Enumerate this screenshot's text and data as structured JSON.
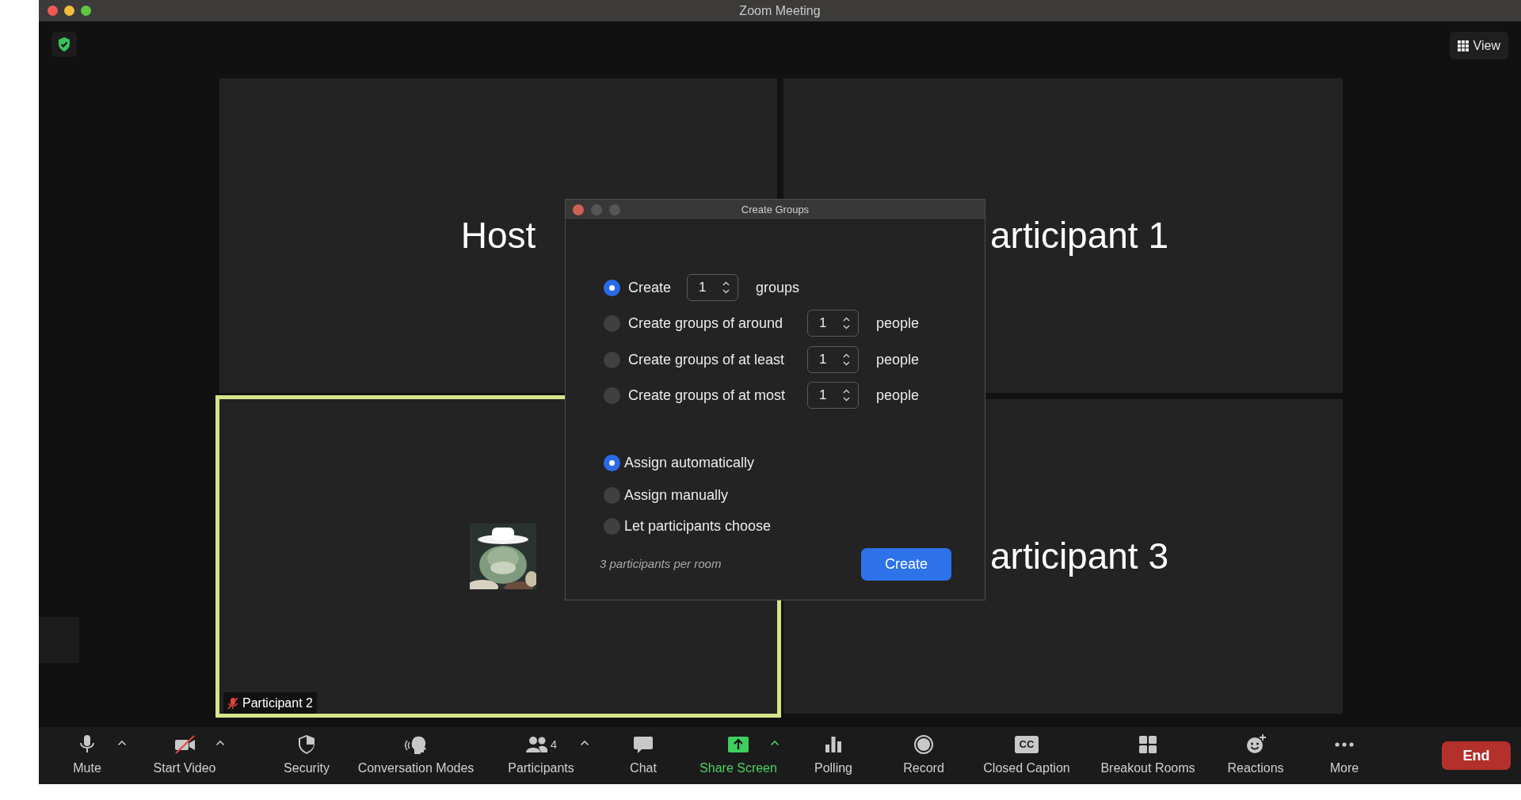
{
  "window": {
    "title": "Zoom Meeting"
  },
  "top_bar": {
    "view_button": "View"
  },
  "tiles": [
    {
      "kind": "label",
      "label": "Host",
      "speaking": false
    },
    {
      "kind": "label",
      "label": "articipant 1",
      "speaking": false
    },
    {
      "kind": "avatar",
      "label": "Participant 2",
      "muted": true,
      "speaking": true
    },
    {
      "kind": "label",
      "label": "articipant 3",
      "speaking": false
    }
  ],
  "dialog": {
    "title": "Create Groups",
    "group_options": [
      {
        "label": "Create",
        "value": "1",
        "unit": "groups",
        "selected": true
      },
      {
        "label": "Create groups of around",
        "value": "1",
        "unit": "people",
        "selected": false
      },
      {
        "label": "Create groups of at least",
        "value": "1",
        "unit": "people",
        "selected": false
      },
      {
        "label": "Create groups of at most",
        "value": "1",
        "unit": "people",
        "selected": false
      }
    ],
    "assign_options": [
      {
        "label": "Assign automatically",
        "selected": true
      },
      {
        "label": "Assign manually",
        "selected": false
      },
      {
        "label": "Let participants choose",
        "selected": false
      }
    ],
    "summary": "3 participants per room",
    "button": "Create"
  },
  "toolbar": {
    "items": [
      {
        "label": "Mute",
        "caret": true,
        "highlighted": false
      },
      {
        "label": "Start Video",
        "caret": true,
        "highlighted": false
      },
      {
        "label": "Security",
        "caret": false,
        "highlighted": false
      },
      {
        "label": "Conversation Modes",
        "caret": false,
        "highlighted": false
      },
      {
        "label": "Participants",
        "count": "4",
        "caret": true,
        "highlighted": false
      },
      {
        "label": "Chat",
        "caret": false,
        "highlighted": false
      },
      {
        "label": "Share Screen",
        "caret": true,
        "highlighted": true
      },
      {
        "label": "Polling",
        "caret": false,
        "highlighted": false
      },
      {
        "label": "Record",
        "caret": false,
        "highlighted": false
      },
      {
        "label": "Closed Caption",
        "icon_text": "CC",
        "caret": false,
        "highlighted": false
      },
      {
        "label": "Breakout Rooms",
        "caret": false,
        "highlighted": false
      },
      {
        "label": "Reactions",
        "caret": false,
        "highlighted": false
      },
      {
        "label": "More",
        "caret": false,
        "highlighted": false
      }
    ],
    "end_button": "End"
  }
}
